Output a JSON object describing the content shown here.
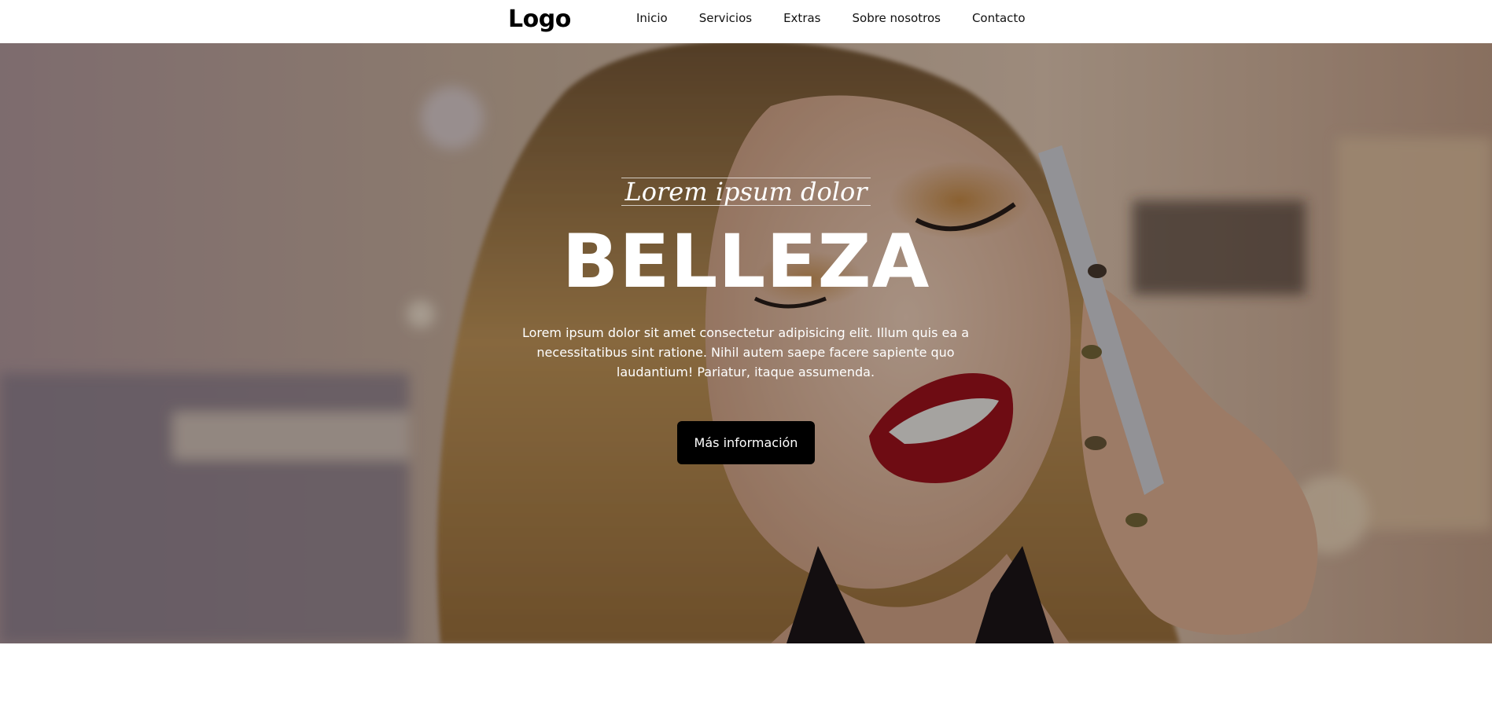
{
  "header": {
    "logo": "Logo",
    "nav": [
      {
        "label": "Inicio"
      },
      {
        "label": "Servicios"
      },
      {
        "label": "Extras"
      },
      {
        "label": "Sobre nosotros"
      },
      {
        "label": "Contacto"
      }
    ]
  },
  "hero": {
    "tagline": "Lorem ipsum dolor",
    "title": "BELLEZA",
    "text": "Lorem ipsum dolor sit amet consectetur adipisicing elit. Illum quis ea a necessitatibus sint ratione. Nihil autem saepe facere sapiente quo laudantium! Pariatur, itaque assumenda.",
    "button_label": "Más información",
    "background_image": "woman-on-phone-photo"
  },
  "colors": {
    "header_bg": "#ffffff",
    "text_dark": "#000000",
    "hero_text": "#ffffff",
    "button_bg": "#000000",
    "lips": "#a3121c"
  }
}
